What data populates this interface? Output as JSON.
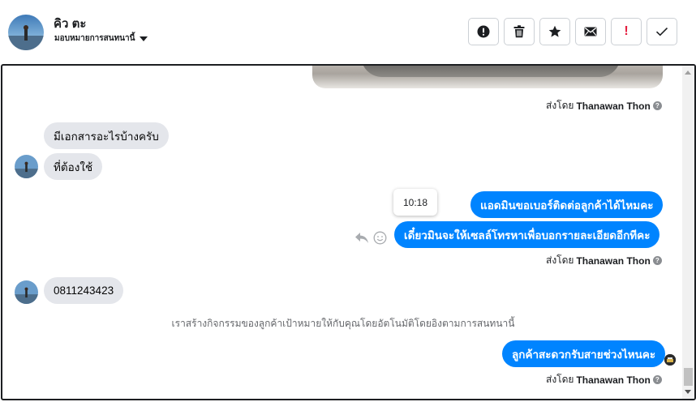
{
  "contact": {
    "name": "คิว ตะ",
    "assign_label": "มอบหมายการสนทนานี้"
  },
  "toolbar": {
    "buttons": [
      {
        "name": "spam-button",
        "icon": "exclamation-circle-icon"
      },
      {
        "name": "delete-button",
        "icon": "trash-icon"
      },
      {
        "name": "star-button",
        "icon": "star-icon"
      },
      {
        "name": "unread-button",
        "icon": "envelope-icon"
      },
      {
        "name": "follow-up-button",
        "icon": "exclamation-icon",
        "label": "!"
      },
      {
        "name": "done-button",
        "icon": "checkmark-icon"
      }
    ],
    "follow_up_label": "!"
  },
  "conversation": {
    "sent_by_prefix": "ส่งโดย",
    "agent_name": "Thanawan Thon",
    "help_glyph": "?",
    "incoming": [
      {
        "text": "มีเอกสารอะไรบ้างครับ"
      },
      {
        "text": "ที่ต้องใช้"
      },
      {
        "text": "0811243423"
      }
    ],
    "outgoing": [
      {
        "text": "แอดมินขอเบอร์ติดต่อลูกค้าได้ไหมคะ"
      },
      {
        "text": "เดี๋ยวมินจะให้เซลล์โทรหาเพื่อบอกรายละเอียดอีกทีคะ"
      },
      {
        "text": "ลูกค้าสะดวกรับสายช่วงไหนคะ"
      }
    ],
    "tooltip_time": "10:18",
    "system_notice": "เราสร้างกิจกรรมของลูกค้าเป้าหมายให้กับคุณโดยอัตโนมัติโดยอิงตามการสนทนานี้"
  },
  "colors": {
    "outgoing_bubble": "#0084ff",
    "incoming_bubble": "#e4e6eb",
    "follow_up_accent": "#e41e3f"
  }
}
